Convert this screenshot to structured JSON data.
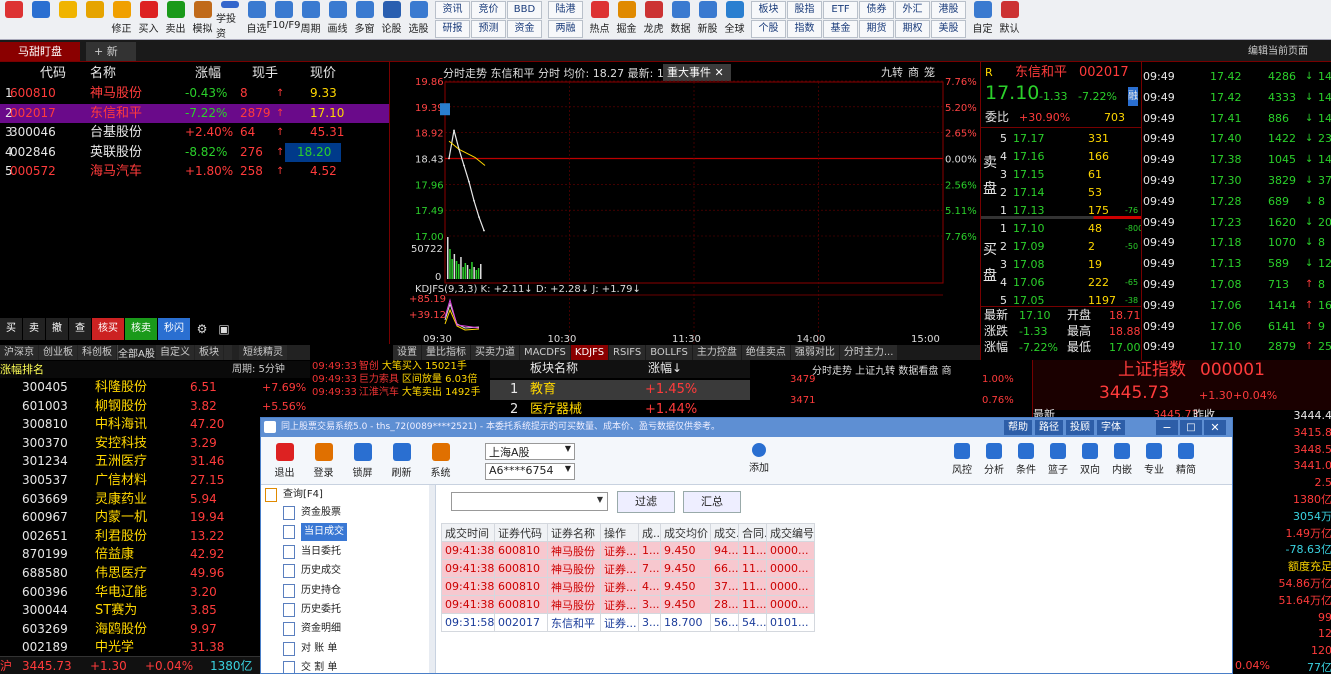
{
  "toolbar": {
    "left_buttons": [
      {
        "label": "",
        "icon": "app-menu-icon",
        "color": "#d33"
      },
      {
        "label": "",
        "icon": "assistant-icon",
        "color": "#2a6fd1"
      },
      {
        "label": "",
        "icon": "back-arrow-icon",
        "color": "#f0b400"
      },
      {
        "label": "",
        "icon": "up-down-arrows-icon",
        "color": "#e6a400"
      },
      {
        "label": "修正",
        "icon": "smile-icon",
        "color": "#f0a000"
      },
      {
        "label": "买入",
        "icon": "buy-icon",
        "color": "#d22"
      },
      {
        "label": "卖出",
        "icon": "sell-icon",
        "color": "#1a9a1a"
      },
      {
        "label": "模拟",
        "icon": "hammer-icon",
        "color": "#c06a1a"
      },
      {
        "label": "学投资",
        "icon": "graduate-cap-icon",
        "color": "#3366cc"
      },
      {
        "label": "自选",
        "icon": "favorites-icon",
        "color": "#3a7ad0"
      },
      {
        "label": "F10/F9",
        "icon": "f10-icon",
        "color": "#3a7ad0"
      },
      {
        "label": "周期",
        "icon": "clock-icon",
        "color": "#3a7ad0"
      },
      {
        "label": "画线",
        "icon": "pen-icon",
        "color": "#3a7ad0"
      },
      {
        "label": "多窗",
        "icon": "multi-window-icon",
        "color": "#3a7ad0"
      },
      {
        "label": "论股",
        "icon": "chat-icon",
        "color": "#2a5fb0"
      },
      {
        "label": "选股",
        "icon": "search-magnifier-icon",
        "color": "#3a7ad0"
      }
    ],
    "grid1": [
      "资讯",
      "资讯",
      "BBD",
      "陆港",
      "热点",
      "掘金",
      "龙虎",
      "数据",
      "新股"
    ],
    "grid1_rows": [
      [
        "资讯",
        "竞价",
        "BBD"
      ],
      [
        "研报",
        "预测",
        "资金"
      ]
    ],
    "grid1b": [
      [
        "陆港"
      ],
      [
        "两融"
      ]
    ],
    "mid_buttons": [
      {
        "label": "热点",
        "icon": "hot-icon",
        "color": "#d33"
      },
      {
        "label": "掘金",
        "icon": "gold-icon",
        "color": "#e08a00"
      },
      {
        "label": "龙虎",
        "icon": "dragon-tiger-icon",
        "color": "#c33"
      },
      {
        "label": "数据",
        "icon": "data-icon",
        "color": "#3a7ad0"
      },
      {
        "label": "新股",
        "icon": "new-stock-icon",
        "color": "#3a7ad0"
      },
      {
        "label": "全球",
        "icon": "globe-icon",
        "color": "#2a7fd0"
      }
    ],
    "grid2_rows": [
      [
        "板块",
        "股指",
        "ETF",
        "债券",
        "外汇",
        "港股"
      ],
      [
        "个股",
        "指数",
        "基金",
        "期货",
        "期权",
        "美股"
      ]
    ],
    "right_buttons": [
      {
        "label": "自定",
        "icon": "customize-icon",
        "color": "#3a7ad0"
      },
      {
        "label": "默认",
        "icon": "home-icon",
        "color": "#c33"
      }
    ]
  },
  "tabs": {
    "active": "马甜盯盘",
    "add": "+ 新建",
    "edit_page": "编辑当前页面"
  },
  "watch": {
    "headers": [
      "代码",
      "名称",
      "涨幅",
      "现手",
      "现价"
    ],
    "rows": [
      {
        "i": "1",
        "code": "600810",
        "name": "神马股份",
        "chg": "-0.43%",
        "vol": "8",
        "price": "9.33",
        "cc": "red",
        "nc": "red",
        "chgc": "grn",
        "volc": "red",
        "pc": "yel",
        "arrow": "↑"
      },
      {
        "i": "2",
        "code": "002017",
        "name": "东信和平",
        "chg": "-7.22%",
        "vol": "2879",
        "price": "17.10",
        "cc": "red",
        "nc": "red",
        "chgc": "grn",
        "volc": "red",
        "pc": "yel",
        "arrow": "↑"
      },
      {
        "i": "3",
        "code": "300046",
        "name": "台基股份",
        "chg": "+2.40%",
        "vol": "64",
        "price": "45.31",
        "cc": "wht",
        "nc": "wht",
        "chgc": "red",
        "volc": "red",
        "pc": "red",
        "arrow": "↑"
      },
      {
        "i": "4",
        "code": "002846",
        "name": "英联股份",
        "chg": "-8.82%",
        "vol": "276",
        "price": "18.20",
        "cc": "wht",
        "nc": "wht",
        "chgc": "grn",
        "volc": "red",
        "pc": "grn",
        "arrow": "↑"
      },
      {
        "i": "5",
        "code": "000572",
        "name": "海马汽车",
        "chg": "+1.80%",
        "vol": "258",
        "price": "4.52",
        "cc": "red",
        "nc": "red",
        "chgc": "red",
        "volc": "red",
        "pc": "red",
        "arrow": "↑"
      }
    ]
  },
  "quick_buttons": [
    "买",
    "卖",
    "撤",
    "查",
    "核买",
    "核卖",
    "秒闪"
  ],
  "lower_tabs": [
    "沪深京",
    "创业板",
    "科创板",
    "自选股",
    "自定义",
    "板块",
    "",
    "短线精灵"
  ],
  "lower_header": {
    "title": "涨幅排名",
    "period": "周期: 5分钟"
  },
  "rank_rows": [
    {
      "code": "300405",
      "name": "科隆股份",
      "price": "6.51",
      "chg": "+7.69%"
    },
    {
      "code": "601003",
      "name": "柳钢股份",
      "price": "3.82",
      "chg": "+5.56%"
    },
    {
      "code": "300810",
      "name": "中科海讯",
      "price": "47.20",
      "chg": ""
    },
    {
      "code": "300370",
      "name": "安控科技",
      "price": "3.29",
      "chg": ""
    },
    {
      "code": "301234",
      "name": "五洲医疗",
      "price": "31.46",
      "chg": ""
    },
    {
      "code": "300537",
      "name": "广信材料",
      "price": "27.15",
      "chg": ""
    },
    {
      "code": "603669",
      "name": "灵康药业",
      "price": "5.94",
      "chg": ""
    },
    {
      "code": "600967",
      "name": "内蒙一机",
      "price": "19.94",
      "chg": ""
    },
    {
      "code": "002651",
      "name": "利君股份",
      "price": "13.22",
      "chg": ""
    },
    {
      "code": "870199",
      "name": "倍益康",
      "price": "42.92",
      "chg": ""
    },
    {
      "code": "688580",
      "name": "伟思医疗",
      "price": "49.96",
      "chg": ""
    },
    {
      "code": "600396",
      "name": "华电辽能",
      "price": "3.20",
      "chg": ""
    },
    {
      "code": "300044",
      "name": "ST赛为",
      "price": "3.85",
      "chg": ""
    },
    {
      "code": "603269",
      "name": "海鸥股份",
      "price": "9.97",
      "chg": ""
    },
    {
      "code": "002189",
      "name": "中光学",
      "price": "31.38",
      "chg": ""
    }
  ],
  "bottom_status": {
    "label": "沪",
    "value": "3445.73",
    "chg": "+1.30",
    "pct": "+0.04%",
    "amount": "1380亿"
  },
  "elves": [
    {
      "time": "09:49:33",
      "code": "智创",
      "text": "大笔买入 15021手"
    },
    {
      "time": "09:49:33",
      "code": "巨力索具",
      "text": "区间放量 6.03倍"
    },
    {
      "time": "09:49:33",
      "code": "江淮汽车",
      "text": "大笔卖出 1492手"
    }
  ],
  "sector": {
    "filter": "全部A股",
    "header_name": "板块名称",
    "header_chg": "涨幅↓",
    "rows": [
      {
        "i": "1",
        "name": "教育",
        "chg": "+1.45%"
      },
      {
        "i": "2",
        "name": "医疗器械",
        "chg": "+1.44%"
      }
    ]
  },
  "chart": {
    "title": "分时走势 东信和平 分时 均价: 18.27 最新: 17",
    "event": "重大事件",
    "right_btns": [
      "九转",
      "商",
      "笼"
    ],
    "price_ticks": [
      "19.86",
      "19.39",
      "18.92",
      "18.43",
      "17.96",
      "17.49",
      "17.00"
    ],
    "pct_ticks": [
      "7.76%",
      "5.20%",
      "2.65%",
      "0.00%",
      "2.56%",
      "5.11%",
      "7.76%"
    ],
    "vol_tick": "50722",
    "vol_zero": "0",
    "ind_label": "KDJFS(9,3,3) K: +2.11↓ D: +2.28↓ J: +1.79↓",
    "ind_ticks": [
      "+85.19",
      "+39.12"
    ],
    "time_ticks": [
      "09:30",
      "10:30",
      "11:30",
      "14:00",
      "15:00"
    ],
    "ind_tabs": [
      "设置",
      "量比指标",
      "买卖力道",
      "MACDFS",
      "KDJFS",
      "RSIFS",
      "BOLLFS",
      "主力控盘",
      "绝佳卖点",
      "强弱对比",
      "分时主力..."
    ],
    "mini_title": "分时走势 上证九转 数据看盘 商",
    "mini_ticks": [
      "3479",
      "3471"
    ],
    "mini_pct": [
      "1.00%",
      "0.76%"
    ]
  },
  "chart_data": {
    "type": "line",
    "title": "",
    "x": [
      "09:30",
      "09:33",
      "09:36",
      "09:39",
      "09:42",
      "09:45",
      "09:48",
      "09:49"
    ],
    "series": [
      {
        "name": "",
        "values": [
          18.43,
          18.95,
          18.6,
          18.3,
          18.0,
          17.65,
          17.35,
          17.1
        ]
      }
    ],
    "ylim": [
      17.0,
      19.86
    ]
  },
  "quote": {
    "flag": "R",
    "name": "东信和平",
    "code": "002017",
    "price": "17.10",
    "chg": "-1.33",
    "pct": "-7.22%",
    "tag": "融",
    "wb_label": "委比",
    "wb": "+30.90%",
    "wc": "703",
    "sells": [
      {
        "n": "5",
        "p": "17.17",
        "v": "331",
        "x": ""
      },
      {
        "n": "4",
        "p": "17.16",
        "v": "166",
        "x": ""
      },
      {
        "n": "3",
        "p": "17.15",
        "v": "61",
        "x": ""
      },
      {
        "n": "2",
        "p": "17.14",
        "v": "53",
        "x": ""
      },
      {
        "n": "1",
        "p": "17.13",
        "v": "175",
        "x": "-76"
      }
    ],
    "buys": [
      {
        "n": "1",
        "p": "17.10",
        "v": "48",
        "x": "-800"
      },
      {
        "n": "2",
        "p": "17.09",
        "v": "2",
        "x": "-50"
      },
      {
        "n": "3",
        "p": "17.08",
        "v": "19",
        "x": ""
      },
      {
        "n": "4",
        "p": "17.06",
        "v": "222",
        "x": "-65"
      },
      {
        "n": "5",
        "p": "17.05",
        "v": "1197",
        "x": "-38"
      }
    ],
    "sell_side": "卖盘",
    "buy_side": "买盘",
    "stats": [
      [
        "最新",
        "17.10",
        "开盘",
        "18.71"
      ],
      [
        "涨跌",
        "-1.33",
        "最高",
        "18.88"
      ],
      [
        "涨幅",
        "-7.22%",
        "最低",
        "17.00"
      ]
    ]
  },
  "ticks": [
    {
      "t": "09:49",
      "p": "17.42",
      "v": "4286",
      "x": "14"
    },
    {
      "t": "09:49",
      "p": "17.42",
      "v": "4333",
      "x": "14"
    },
    {
      "t": "09:49",
      "p": "17.41",
      "v": "886",
      "x": "14"
    },
    {
      "t": "09:49",
      "p": "17.40",
      "v": "1422",
      "x": "23"
    },
    {
      "t": "09:49",
      "p": "17.38",
      "v": "1045",
      "x": "14"
    },
    {
      "t": "09:49",
      "p": "17.30",
      "v": "3829",
      "x": "37"
    },
    {
      "t": "09:49",
      "p": "17.28",
      "v": "689",
      "x": "8"
    },
    {
      "t": "09:49",
      "p": "17.23",
      "v": "1620",
      "x": "20"
    },
    {
      "t": "09:49",
      "p": "17.18",
      "v": "1070",
      "x": "8"
    },
    {
      "t": "09:49",
      "p": "17.13",
      "v": "589",
      "x": "12"
    },
    {
      "t": "09:49",
      "p": "17.08",
      "v": "713",
      "x": "8"
    },
    {
      "t": "09:49",
      "p": "17.06",
      "v": "1414",
      "x": "16"
    },
    {
      "t": "09:49",
      "p": "17.06",
      "v": "6141",
      "x": "9"
    },
    {
      "t": "09:49",
      "p": "17.10",
      "v": "2879",
      "x": "25"
    }
  ],
  "index": {
    "name": "上证指数",
    "code": "000001",
    "value": "3445.73",
    "chg": "+1.30",
    "pct": "+0.04%",
    "latest_label": "最新",
    "latest_val": "3445.73",
    "prev_label": "昨收"
  },
  "index_right": [
    "3444.4",
    "3415.8",
    "3448.5",
    "3441.0",
    "2.5",
    "1380亿",
    "3054万",
    "1.49万亿",
    "-78.63亿",
    "额度充足",
    "54.86万亿",
    "51.64万亿",
    "99",
    "12",
    "120",
    "77亿"
  ],
  "bottom_right": {
    "pct": "0.04%"
  },
  "dialog": {
    "title": "同上股票交易系统5.0 - ths_72(0089****2521) - 本委托系统提示的可买数量、成本价、盈亏数据仅供参考。",
    "title_btns": [
      "帮助",
      "路径",
      "投顾",
      "字体"
    ],
    "tools": [
      {
        "label": "退出",
        "icon": "exit-icon",
        "color": "#d22"
      },
      {
        "label": "登录",
        "icon": "login-icon",
        "color": "#e07000"
      },
      {
        "label": "锁屏",
        "icon": "lock-icon",
        "color": "#2a6fd1"
      },
      {
        "label": "刷新",
        "icon": "refresh-icon",
        "color": "#2a6fd1"
      },
      {
        "label": "系统",
        "icon": "system-icon",
        "color": "#e07000"
      }
    ],
    "market": "上海A股",
    "account": "A6****6754",
    "add_label": "添加",
    "right_tools": [
      {
        "label": "风控",
        "icon": "risk-icon"
      },
      {
        "label": "分析",
        "icon": "analysis-icon"
      },
      {
        "label": "条件",
        "icon": "condition-icon"
      },
      {
        "label": "篮子",
        "icon": "basket-icon"
      },
      {
        "label": "双向",
        "icon": "two-way-icon"
      },
      {
        "label": "内嵌",
        "icon": "embed-icon"
      },
      {
        "label": "专业",
        "icon": "pro-icon"
      },
      {
        "label": "精简",
        "icon": "simple-icon"
      }
    ],
    "tree_root": "查询[F4]",
    "tree": [
      "资金股票",
      "当日成交",
      "当日委托",
      "历史成交",
      "历史持仓",
      "历史委托",
      "资金明细",
      "对 账 单",
      "交 割 单"
    ],
    "tree_selected": "当日成交",
    "filter_btn": "过滤",
    "sum_btn": "汇总",
    "cols": [
      "成交时间",
      "证券代码",
      "证券名称",
      "操作",
      "成...",
      "成交均价",
      "成交...",
      "合同...",
      "成交编号"
    ],
    "rows": [
      [
        "09:41:38",
        "600810",
        "神马股份",
        "证券...",
        "1...",
        "9.450",
        "94...",
        "11...",
        "0000..."
      ],
      [
        "09:41:38",
        "600810",
        "神马股份",
        "证券...",
        "7...",
        "9.450",
        "66...",
        "11...",
        "0000..."
      ],
      [
        "09:41:38",
        "600810",
        "神马股份",
        "证券...",
        "4...",
        "9.450",
        "37...",
        "11...",
        "0000..."
      ],
      [
        "09:41:38",
        "600810",
        "神马股份",
        "证券...",
        "3...",
        "9.450",
        "28...",
        "11...",
        "0000..."
      ],
      [
        "09:31:58",
        "002017",
        "东信和平",
        "证券...",
        "3...",
        "18.700",
        "56...",
        "54...",
        "0101..."
      ]
    ]
  }
}
